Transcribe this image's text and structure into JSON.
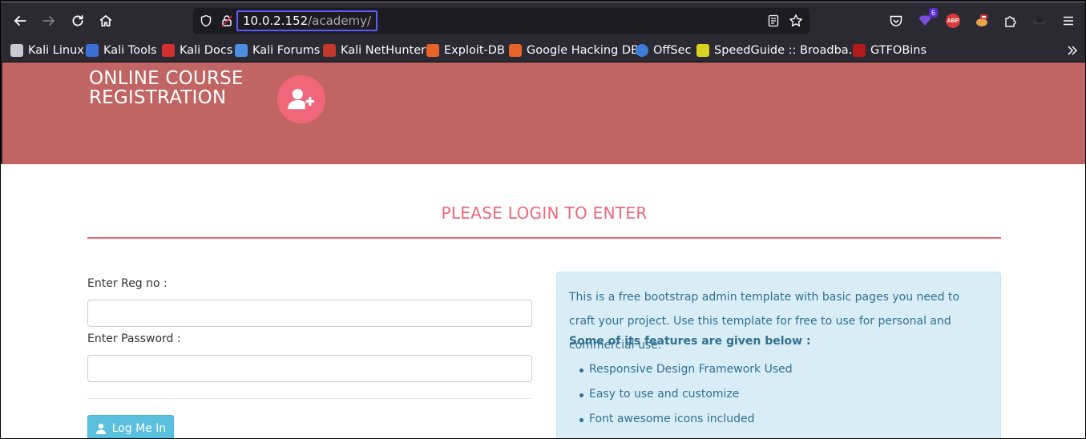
{
  "browser": {
    "url_host": "10.0.2.152",
    "url_path": "/academy/",
    "extension_badge": "6",
    "abp_label": "ABP",
    "bookmarks": [
      {
        "label": "Kali Linux",
        "icon": "kali-dragon-icon",
        "color": "#c9c9d1"
      },
      {
        "label": "Kali Tools",
        "icon": "kali-tools-icon",
        "color": "#3b6fd6"
      },
      {
        "label": "Kali Docs",
        "icon": "kali-docs-icon",
        "color": "#d32f2f"
      },
      {
        "label": "Kali Forums",
        "icon": "kali-forums-icon",
        "color": "#4a8fe0"
      },
      {
        "label": "Kali NetHunter",
        "icon": "nethunter-icon",
        "color": "#c0392b"
      },
      {
        "label": "Exploit-DB",
        "icon": "exploit-db-icon",
        "color": "#e8622c"
      },
      {
        "label": "Google Hacking DB",
        "icon": "ghdb-icon",
        "color": "#e8622c"
      },
      {
        "label": "OffSec",
        "icon": "offsec-icon",
        "color": "#3e7ad8"
      },
      {
        "label": "SpeedGuide :: Broadba…",
        "icon": "speedguide-icon",
        "color": "#d9d320"
      },
      {
        "label": "GTFOBins",
        "icon": "gtfobins-icon",
        "color": "#b31b1b"
      }
    ]
  },
  "header": {
    "brand_line1": "ONLINE COURSE",
    "brand_line2": "REGISTRATION",
    "brand_icon": "user-plus-icon",
    "hero_color": "#c06563",
    "accent_color": "#f0677c"
  },
  "login": {
    "heading": "PLEASE LOGIN TO ENTER",
    "reg_label": "Enter Reg no :",
    "reg_value": "",
    "password_label": "Enter Password :",
    "password_value": "",
    "button_label": "Log Me In",
    "button_icon": "user-icon"
  },
  "info": {
    "paragraph1": "This is a free bootstrap admin template with basic pages you need to craft your project. Use this template for free to use for personal and commercial use.",
    "features_title": "Some of its features are given below :",
    "features": [
      "Responsive Design Framework Used",
      "Easy to use and customize",
      "Font awesome icons included"
    ]
  }
}
